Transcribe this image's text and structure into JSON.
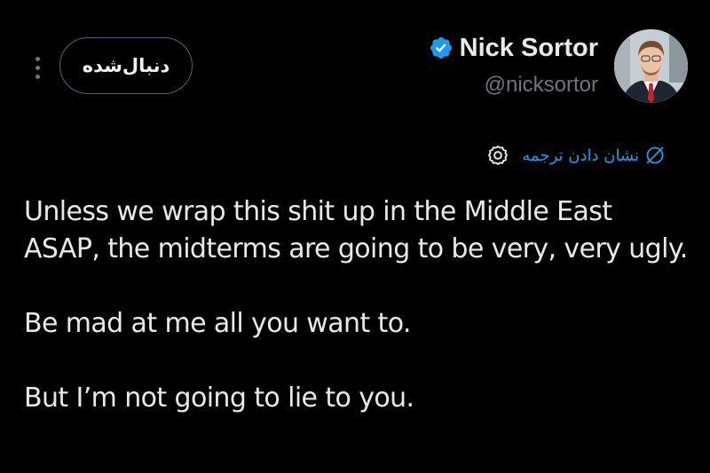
{
  "header": {
    "display_name": "Nick Sortor",
    "handle": "@nicksortor",
    "follow_button_label": "دنبال‌شده",
    "verified_icon": "verified-badge-icon",
    "more_icon": "more-vertical-icon"
  },
  "translate": {
    "label": "نشان دادن ترجمه",
    "icon": "translate-icon",
    "settings_icon": "gear-icon"
  },
  "tweet": {
    "paragraphs": [
      "Unless we wrap this shit up in the Middle East ASAP, the midterms are going to be very, very ugly.",
      "Be mad at me all you want to.",
      "But I’m not going to lie to you."
    ]
  },
  "colors": {
    "background": "#000000",
    "text": "#e7e9ea",
    "secondary_text": "#71767b",
    "accent": "#1d9bf0",
    "button_border": "#536471"
  }
}
